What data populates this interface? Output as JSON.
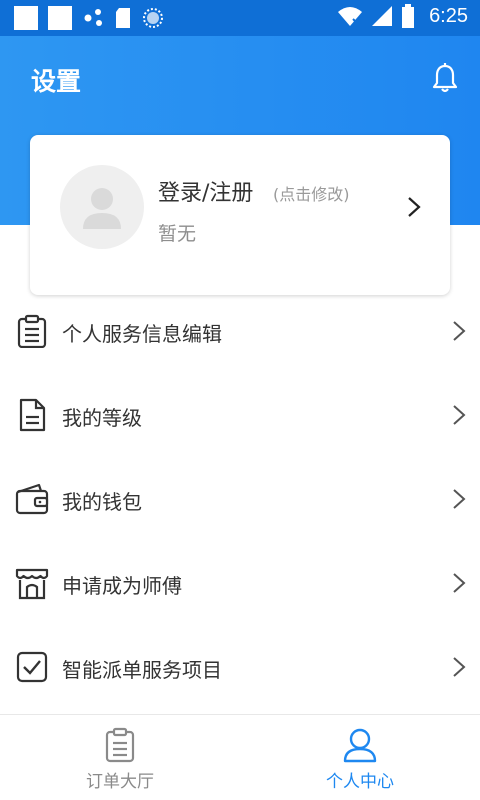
{
  "status_bar": {
    "time": "6:25"
  },
  "header": {
    "title": "设置"
  },
  "profile": {
    "login_label": "登录/注册",
    "edit_hint": "(点击修改)",
    "subtitle": "暂无"
  },
  "menu": {
    "items": [
      {
        "label": "个人服务信息编辑",
        "icon": "clipboard-icon"
      },
      {
        "label": "我的等级",
        "icon": "document-icon"
      },
      {
        "label": "我的钱包",
        "icon": "wallet-icon"
      },
      {
        "label": "申请成为师傅",
        "icon": "shop-icon"
      },
      {
        "label": "智能派单服务项目",
        "icon": "checkbox-icon"
      }
    ]
  },
  "tabbar": {
    "tabs": [
      {
        "label": "订单大厅",
        "icon": "clipboard-icon",
        "active": false
      },
      {
        "label": "个人中心",
        "icon": "person-icon",
        "active": true
      }
    ]
  },
  "colors": {
    "primary": "#1f86f0",
    "active_tab": "#1e88f0",
    "inactive_tab": "#8a8a8a",
    "status_bar": "#0f6fd6"
  }
}
